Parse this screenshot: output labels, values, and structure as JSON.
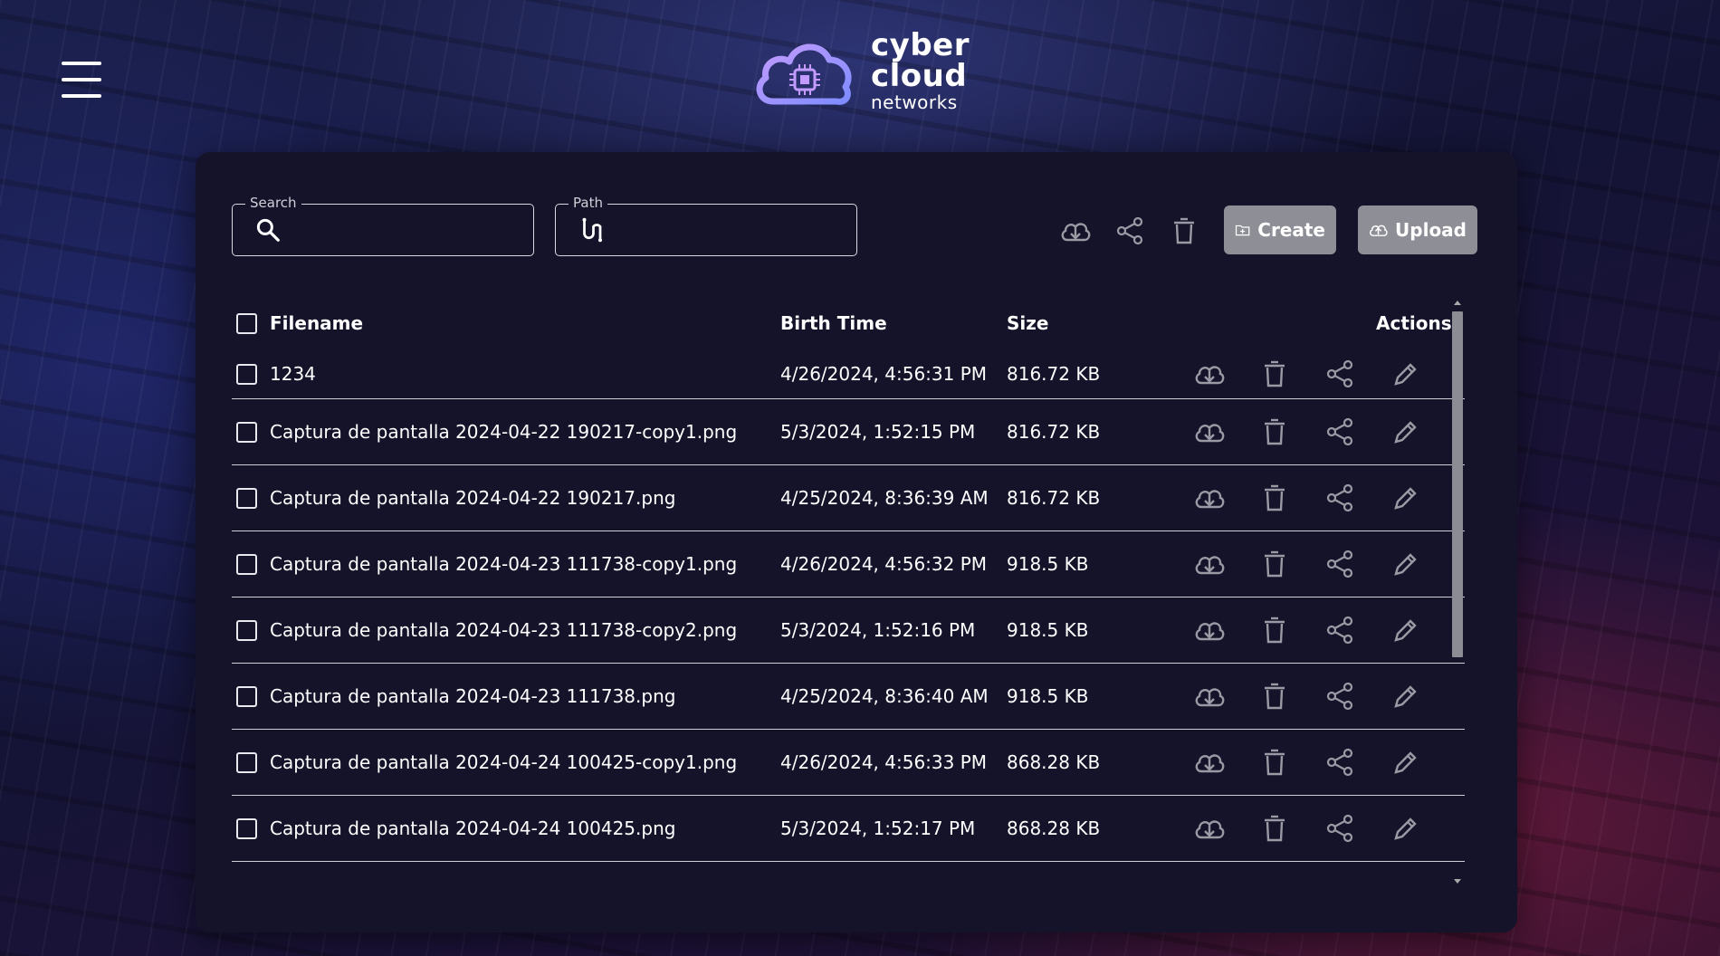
{
  "logo": {
    "line1": "cyber",
    "line2": "cloud",
    "line3": "networks"
  },
  "search": {
    "label": "Search",
    "value": ""
  },
  "path": {
    "label": "Path",
    "value": ""
  },
  "toolbar": {
    "create_label": "Create",
    "upload_label": "Upload"
  },
  "table": {
    "headers": {
      "filename": "Filename",
      "birth": "Birth Time",
      "size": "Size",
      "actions": "Actions"
    },
    "rows": [
      {
        "name": "1234",
        "birth": "4/26/2024, 4:56:31 PM",
        "size": "816.72 KB"
      },
      {
        "name": "Captura de pantalla 2024-04-22 190217-copy1.png",
        "birth": "5/3/2024, 1:52:15 PM",
        "size": "816.72 KB"
      },
      {
        "name": "Captura de pantalla 2024-04-22 190217.png",
        "birth": "4/25/2024, 8:36:39 AM",
        "size": "816.72 KB"
      },
      {
        "name": "Captura de pantalla 2024-04-23 111738-copy1.png",
        "birth": "4/26/2024, 4:56:32 PM",
        "size": "918.5 KB"
      },
      {
        "name": "Captura de pantalla 2024-04-23 111738-copy2.png",
        "birth": "5/3/2024, 1:52:16 PM",
        "size": "918.5 KB"
      },
      {
        "name": "Captura de pantalla 2024-04-23 111738.png",
        "birth": "4/25/2024, 8:36:40 AM",
        "size": "918.5 KB"
      },
      {
        "name": "Captura de pantalla 2024-04-24 100425-copy1.png",
        "birth": "4/26/2024, 4:56:33 PM",
        "size": "868.28 KB"
      },
      {
        "name": "Captura de pantalla 2024-04-24 100425.png",
        "birth": "5/3/2024, 1:52:17 PM",
        "size": "868.28 KB"
      }
    ]
  },
  "icons": {
    "menu": "hamburger-menu-icon",
    "search": "search-icon",
    "path": "path-icon",
    "download": "cloud-download-icon",
    "share": "share-icon",
    "delete": "trash-icon",
    "edit": "pencil-icon",
    "create": "folder-plus-icon",
    "upload": "cloud-upload-icon"
  },
  "colors": {
    "panel": "#15132a",
    "button": "#8e8e96",
    "logo_accent": "#a77bff"
  }
}
